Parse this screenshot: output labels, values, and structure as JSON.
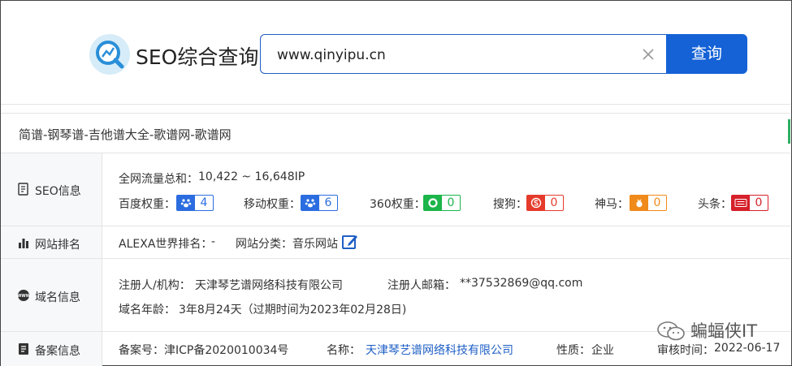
{
  "header": {
    "logo_text": "SEO综合查询",
    "search_value": "www.qinyipu.cn",
    "search_button": "查询"
  },
  "site_title": "简谱-钢琴谱-吉他谱大全-歌谱网-歌谱网",
  "seo": {
    "label": "SEO信息",
    "traffic_label": "全网流量总和：",
    "traffic_value": "10,422 ~ 16,648IP",
    "metrics": [
      {
        "label": "百度权重：",
        "value": "4",
        "color": "#2b6de0",
        "icon": "paw-icon"
      },
      {
        "label": "移动权重：",
        "value": "6",
        "color": "#2b6de0",
        "icon": "paw-icon"
      },
      {
        "label": "360权重：",
        "value": "0",
        "color": "#1bb54a",
        "icon": "circle-360-icon"
      },
      {
        "label": "搜狗：",
        "value": "0",
        "color": "#e53b2c",
        "icon": "sogou-icon"
      },
      {
        "label": "神马：",
        "value": "0",
        "color": "#f08a1a",
        "icon": "shenma-icon"
      },
      {
        "label": "头条：",
        "value": "0",
        "color": "#d6202a",
        "icon": "toutiao-icon"
      }
    ]
  },
  "rank": {
    "label": "网站排名",
    "alexa_label": "ALEXA世界排名：",
    "alexa_value": "-",
    "category_label": "网站分类：",
    "category_value": "音乐网站"
  },
  "domain": {
    "label": "域名信息",
    "registrant_label": "注册人/机构：",
    "registrant_value": "天津琴艺谱网络科技有限公司",
    "email_label": "注册人邮箱：",
    "email_value": "**37532869@qq.com",
    "age_label": "域名年龄：",
    "age_value": "3年8月24天（过期时间为2023年02月28日)"
  },
  "icp": {
    "label": "备案信息",
    "number_label": "备案号：",
    "number_value": "津ICP备2020010034号",
    "name_label": "名称：",
    "name_value": "天津琴艺谱网络科技有限公司",
    "type_label": "性质：",
    "type_value": "企业",
    "audit_label": "审核时间：",
    "audit_value": "2022-06-17"
  },
  "watermark": "蝙蝠侠IT"
}
